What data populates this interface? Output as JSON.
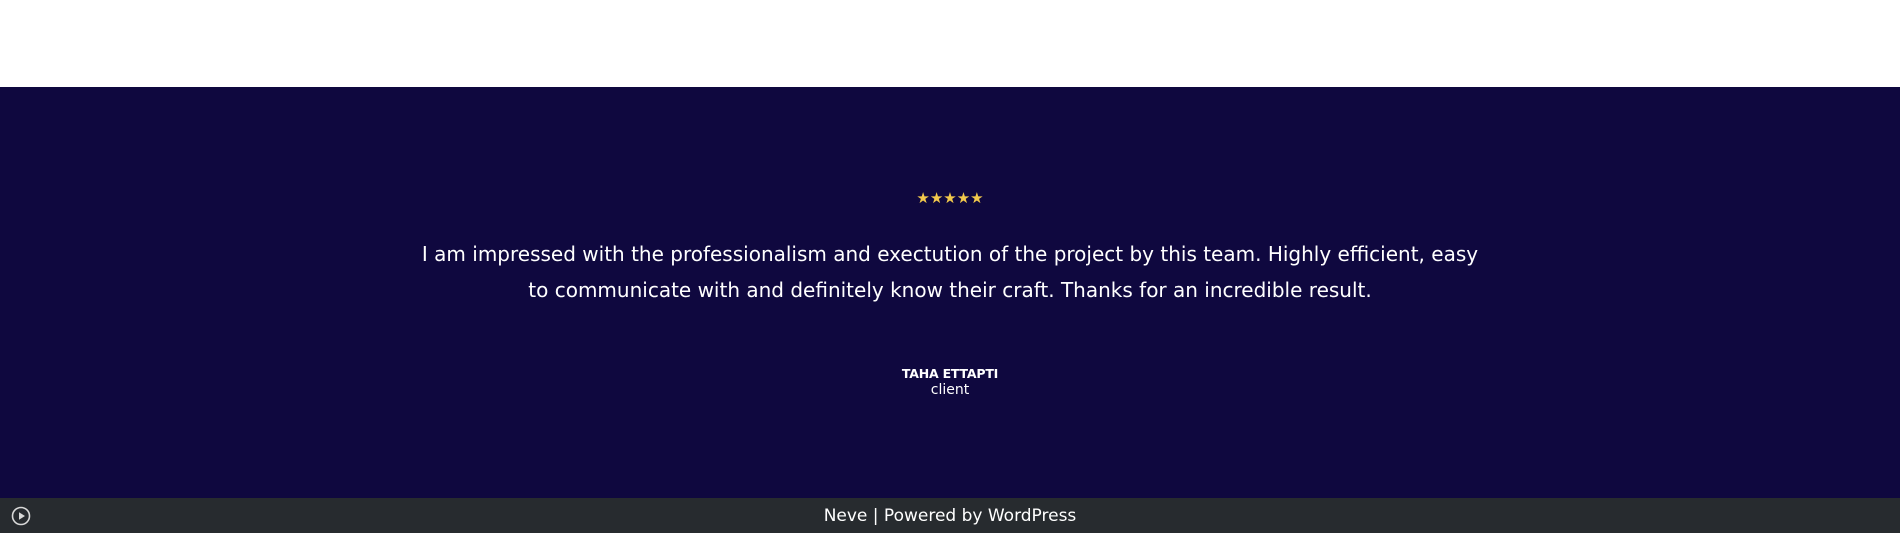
{
  "testimonial": {
    "rating": 5,
    "stars_text": "★★★★★",
    "quote": "I am impressed with the professionalism and exectution of the project by this team. Highly efficient, easy to communicate with and definitely know their craft. Thanks for an incredible result.",
    "author_name": "TAHA ETTAPTI",
    "author_role": "client"
  },
  "footer": {
    "credit_text": "Neve | Powered by WordPress",
    "play_icon": "play-circle-icon"
  },
  "colors": {
    "section_bg": "#0f083f",
    "star": "#f2c94c",
    "footer_bg": "#272b2f",
    "text": "#ffffff"
  }
}
